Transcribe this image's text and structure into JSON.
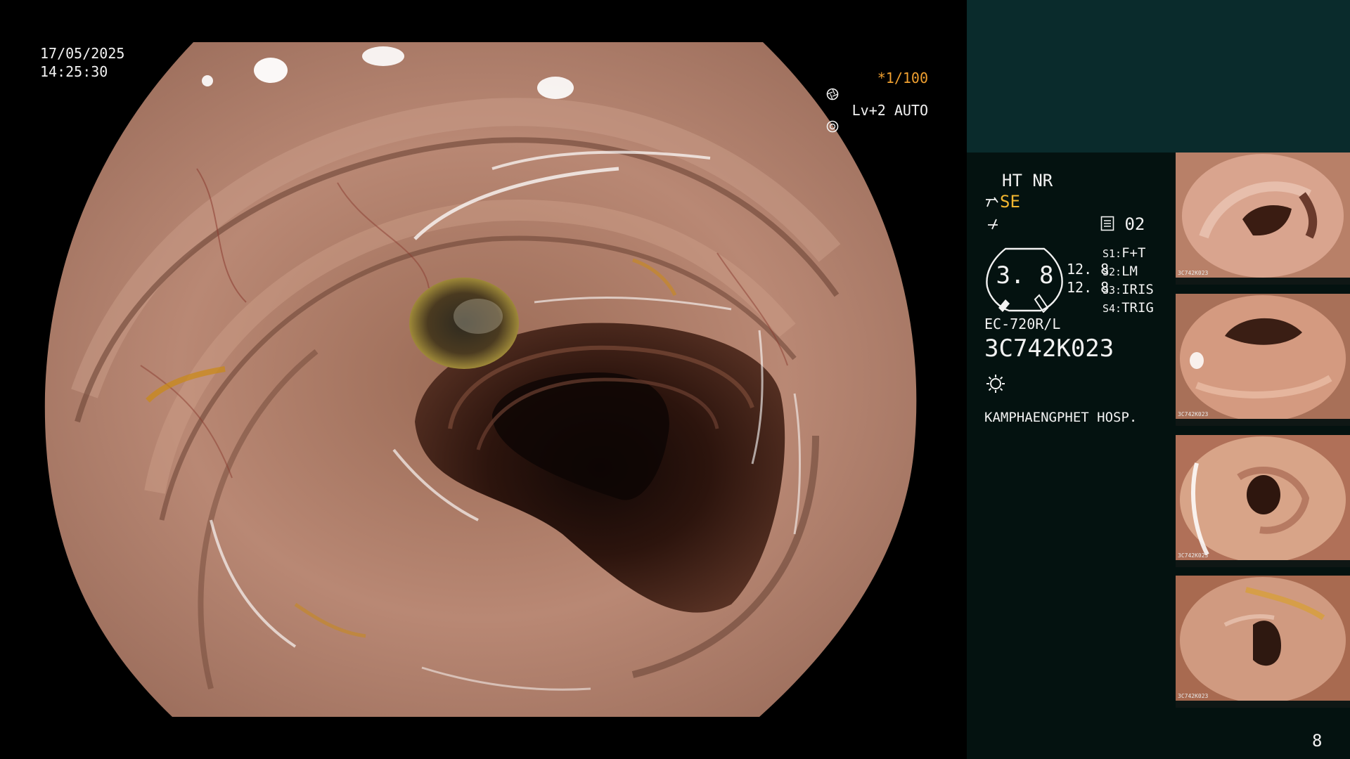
{
  "overlay": {
    "date": "17/05/2025",
    "time": "14:25:30",
    "shutter": "*1/100",
    "level": "Lv+2 AUTO"
  },
  "panel": {
    "mode": "HT NR",
    "se": "SE",
    "counter": "02",
    "meter_value": "3. 8",
    "meter_right_1": "12. 8",
    "meter_right_2": "12. 8",
    "s_keys": [
      {
        "k": "S1:",
        "v": "F+T"
      },
      {
        "k": "S2:",
        "v": "LM"
      },
      {
        "k": "S3:",
        "v": "IRIS"
      },
      {
        "k": "S4:",
        "v": "TRIG"
      }
    ],
    "scope_model": "EC-720R/L",
    "serial": "3C742K023",
    "hospital": "KAMPHAENGPHET HOSP.",
    "page_number": "8"
  },
  "thumbnails": [
    {
      "caption": "3C742K023"
    },
    {
      "caption": "3C742K023"
    },
    {
      "caption": "3C742K023"
    },
    {
      "caption": "3C742K023"
    }
  ],
  "icons": {
    "shutter": "aperture-icon",
    "level": "iris-icon",
    "memo": "memo-icon",
    "light": "light-sun-icon",
    "pen": "pen-icon",
    "freeze": "freeze-icon"
  }
}
